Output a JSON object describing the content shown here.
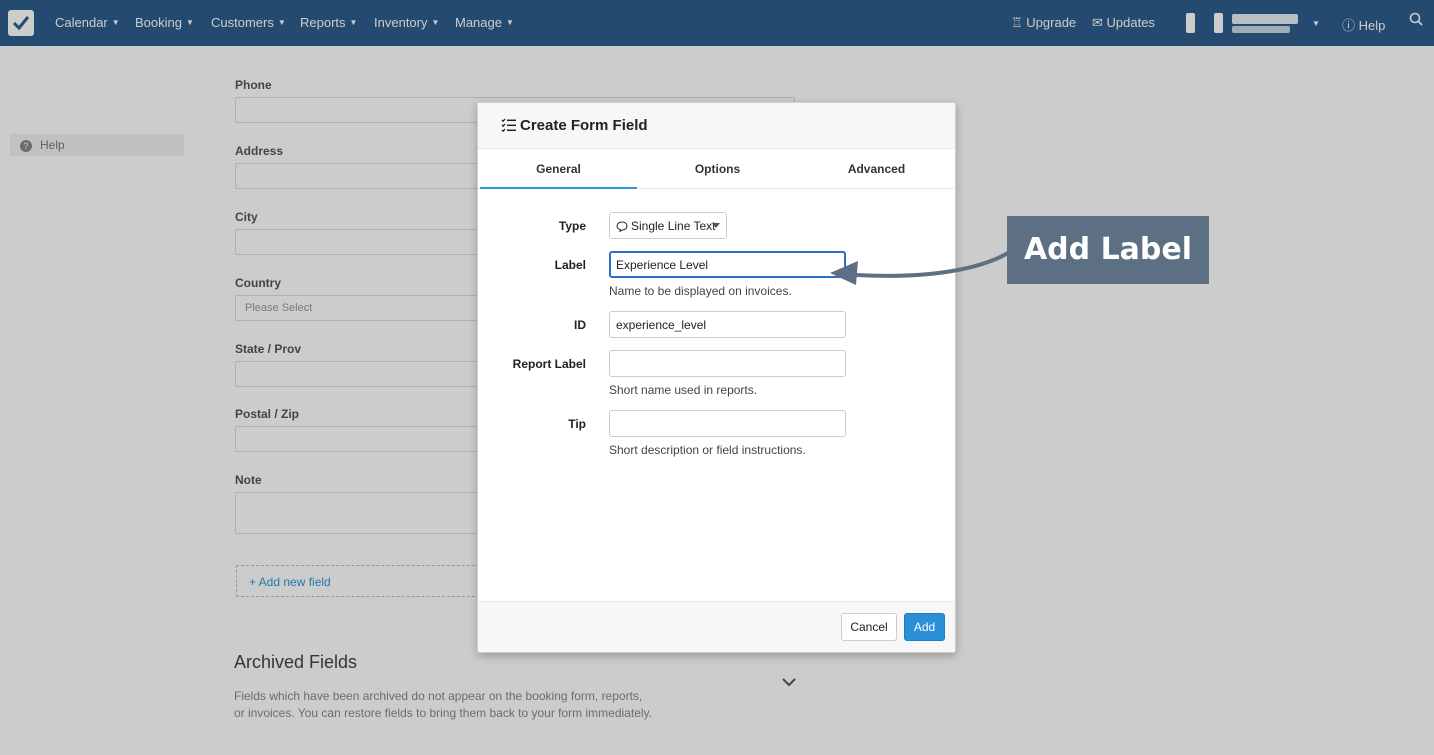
{
  "nav": {
    "items": [
      {
        "label": "Calendar"
      },
      {
        "label": "Booking"
      },
      {
        "label": "Customers"
      },
      {
        "label": "Reports"
      },
      {
        "label": "Inventory"
      },
      {
        "label": "Manage"
      }
    ],
    "upgrade": "Upgrade",
    "updates": "Updates",
    "help": "Help"
  },
  "sidebar": {
    "help": "Help"
  },
  "form_bg": {
    "phone": "Phone",
    "address": "Address",
    "city": "City",
    "country": "Country",
    "country_placeholder": "Please Select",
    "state": "State / Prov",
    "postal": "Postal / Zip",
    "note": "Note",
    "add_new_field": "+ Add new field",
    "archived_title": "Archived Fields",
    "archived_desc": "Fields which have been archived do not appear on the booking form, reports, or invoices. You can restore fields to bring them back to your form immediately."
  },
  "modal": {
    "title": "Create Form Field",
    "tabs": [
      {
        "label": "General",
        "active": true
      },
      {
        "label": "Options"
      },
      {
        "label": "Advanced"
      }
    ],
    "type_label": "Type",
    "type_value": "Single Line Text",
    "label_label": "Label",
    "label_value": "Experience Level",
    "label_help": "Name to be displayed on invoices.",
    "id_label": "ID",
    "id_value": "experience_level",
    "report_label_label": "Report Label",
    "report_label_value": "",
    "report_label_help": "Short name used in reports.",
    "tip_label": "Tip",
    "tip_value": "",
    "tip_help": "Short description or field instructions.",
    "cancel": "Cancel",
    "add": "Add"
  },
  "callout": {
    "text": "Add Label"
  },
  "colors": {
    "nav_bg": "#2f5d8c",
    "accent": "#2a9bd8",
    "primary_button": "#2a8fd6",
    "callout_bg": "#5d7083"
  }
}
